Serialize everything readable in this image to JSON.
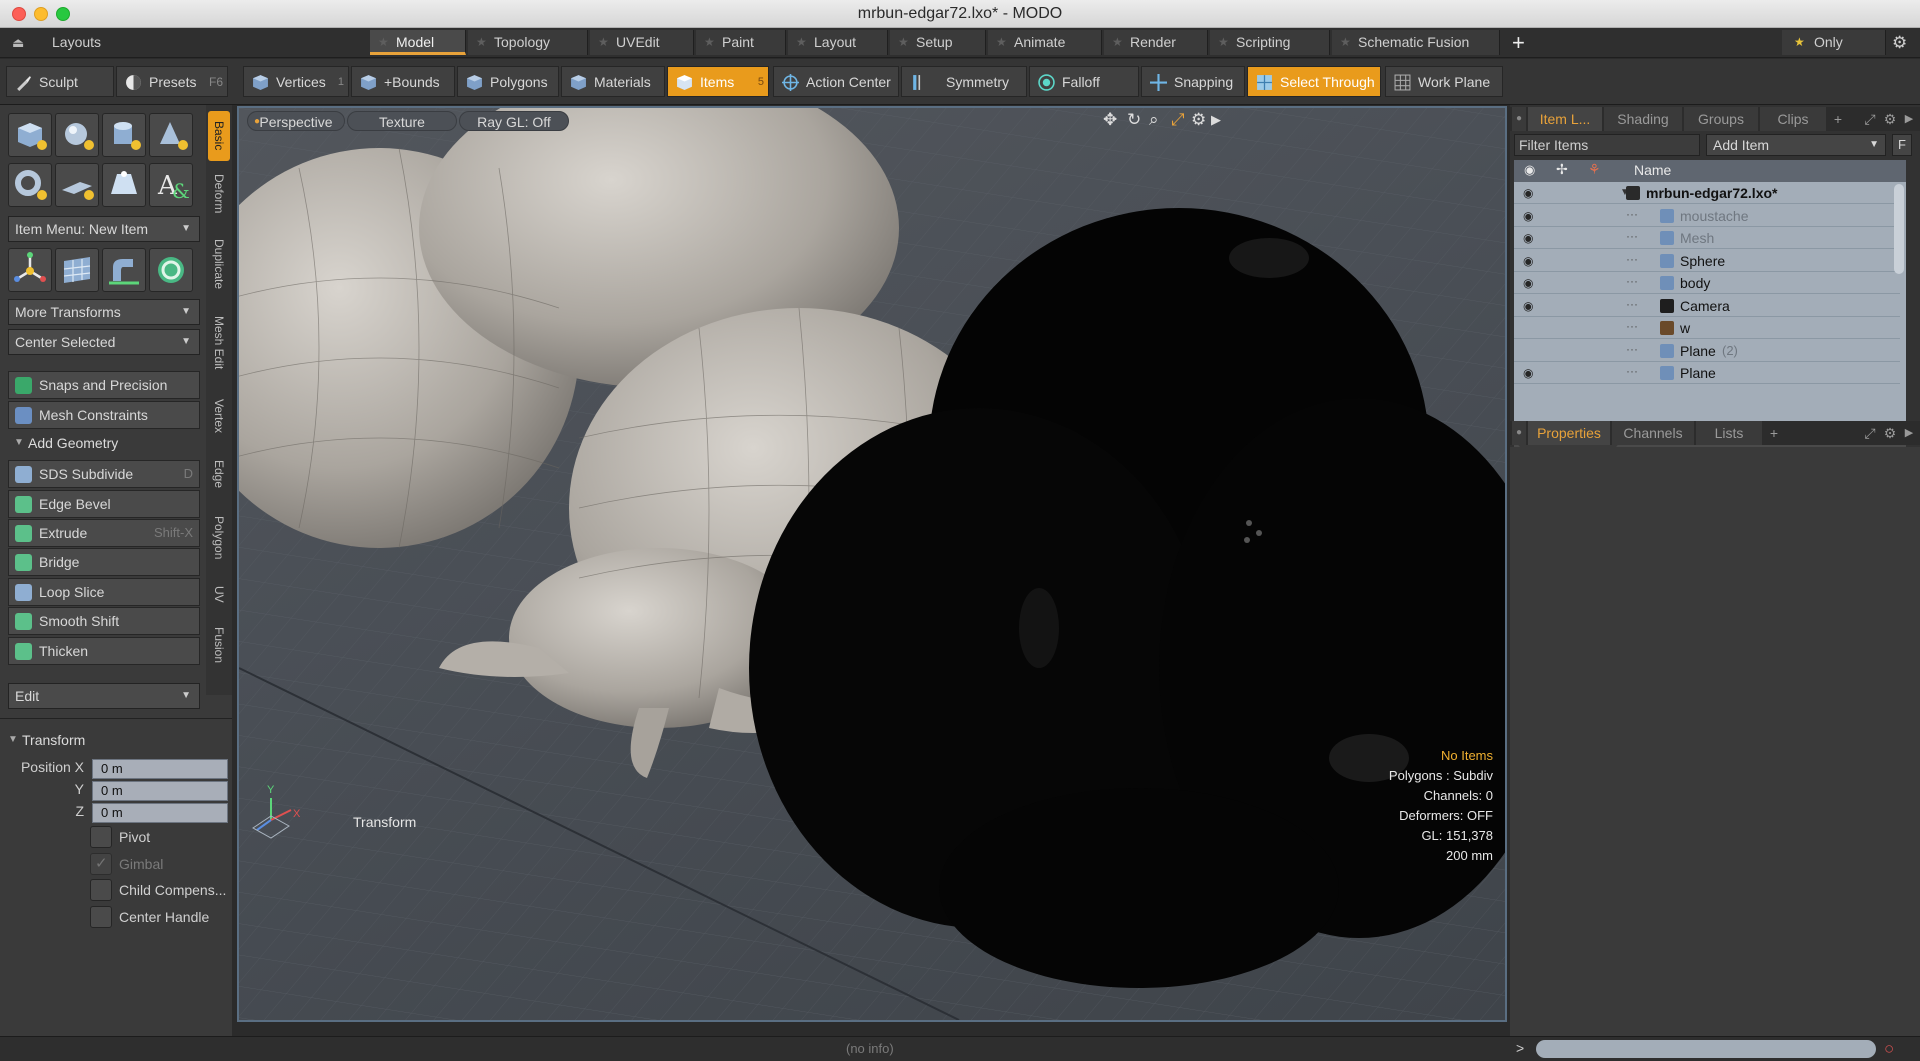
{
  "window": {
    "title": "mrbun-edgar72.lxo* - MODO"
  },
  "layouts_bar": {
    "layouts_label": "Layouts",
    "tabs": [
      "Model",
      "Topology",
      "UVEdit",
      "Paint",
      "Layout",
      "Setup",
      "Animate",
      "Render",
      "Scripting",
      "Schematic Fusion"
    ],
    "active_tab": "Model",
    "add_tab": "+",
    "only_label": "Only"
  },
  "toolbar": {
    "sculpt": "Sculpt",
    "presets": "Presets",
    "presets_key": "F6",
    "vertices": "Vertices",
    "vertices_num": "1",
    "bounds": "+Bounds",
    "polygons": "Polygons",
    "materials": "Materials",
    "items": "Items",
    "items_num": "5",
    "action_center": "Action Center",
    "symmetry": "Symmetry",
    "falloff": "Falloff",
    "snapping": "Snapping",
    "select_through": "Select Through",
    "work_plane": "Work Plane"
  },
  "left_panel": {
    "vertical_tabs": [
      "Basic",
      "Deform",
      "Duplicate",
      "Mesh Edit",
      "Vertex",
      "Edge",
      "Polygon",
      "UV",
      "Fusion"
    ],
    "item_menu": "Item Menu: New Item",
    "more_transforms": "More Transforms",
    "center_selected": "Center Selected",
    "snaps_precision": "Snaps and Precision",
    "mesh_constraints": "Mesh Constraints",
    "add_geometry": "Add Geometry",
    "tools": [
      {
        "label": "SDS Subdivide",
        "shortcut": "D"
      },
      {
        "label": "Edge Bevel",
        "shortcut": ""
      },
      {
        "label": "Extrude",
        "shortcut": "Shift-X"
      },
      {
        "label": "Bridge",
        "shortcut": ""
      },
      {
        "label": "Loop Slice",
        "shortcut": ""
      },
      {
        "label": "Smooth Shift",
        "shortcut": ""
      },
      {
        "label": "Thicken",
        "shortcut": ""
      }
    ],
    "edit_dropdown": "Edit",
    "transform_header": "Transform",
    "position_label": "Position X",
    "y_label": "Y",
    "z_label": "Z",
    "pos_x": "0 m",
    "pos_y": "0 m",
    "pos_z": "0 m",
    "checks": [
      "Pivot",
      "Gimbal",
      "Child Compens...",
      "Center Handle"
    ]
  },
  "viewport": {
    "view_mode": "Perspective",
    "shading": "Texture",
    "raygl": "Ray GL: Off",
    "tool_label": "Transform",
    "axis_y": "Y",
    "axis_x": "X",
    "info": {
      "selection": "No Items",
      "polygons": "Polygons : Subdiv",
      "channels": "Channels: 0",
      "deformers": "Deformers: OFF",
      "gl": "GL: 151,378",
      "scale": "200 mm"
    }
  },
  "item_list": {
    "tabs": [
      "Item L...",
      "Shading",
      "Groups",
      "Clips"
    ],
    "filter_placeholder": "Filter Items",
    "add_item": "Add Item",
    "f_button": "F",
    "name_header": "Name",
    "scene": "mrbun-edgar72.lxo*",
    "items": [
      {
        "name": "moustache",
        "type": "mesh",
        "visible": true,
        "dim": true
      },
      {
        "name": "Mesh",
        "type": "mesh",
        "visible": true,
        "dim": true
      },
      {
        "name": "Sphere",
        "type": "mesh",
        "visible": true,
        "dim": false
      },
      {
        "name": "body",
        "type": "mesh",
        "visible": true,
        "dim": false
      },
      {
        "name": "Camera",
        "type": "camera",
        "visible": true,
        "dim": false
      },
      {
        "name": "w",
        "type": "image",
        "visible": false,
        "dim": false
      },
      {
        "name": "Plane",
        "suffix": "(2)",
        "type": "mesh",
        "visible": false,
        "dim": false
      },
      {
        "name": "Plane",
        "type": "mesh",
        "visible": true,
        "dim": false
      }
    ]
  },
  "properties": {
    "tabs": [
      "Properties",
      "Channels",
      "Lists"
    ]
  },
  "status": {
    "info": "(no info)",
    "prompt": ">"
  }
}
